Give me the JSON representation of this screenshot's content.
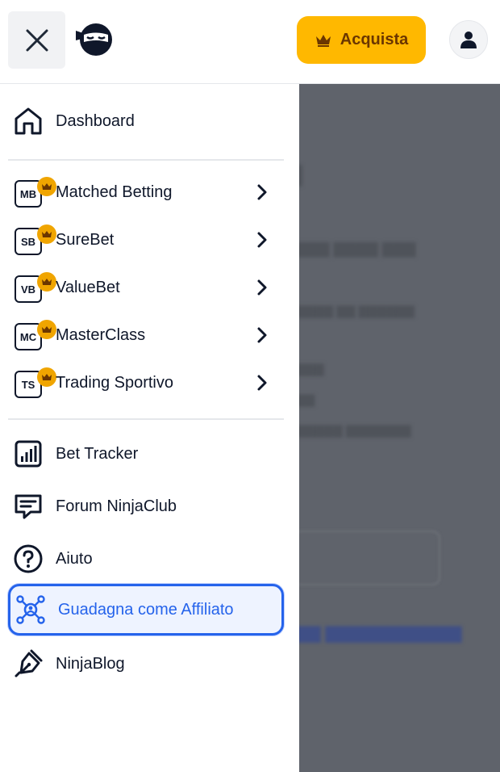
{
  "header": {
    "buy_label": "Acquista"
  },
  "icons": {
    "close": "close-icon",
    "logo": "ninja-logo",
    "crown": "crown-icon",
    "user": "user-icon"
  },
  "colors": {
    "accent": "#ffb800",
    "active": "#2563eb",
    "overlay": "#5f636b",
    "crown_badge": "#f0a500"
  },
  "menu": {
    "dashboard": "Dashboard",
    "premium": [
      {
        "label": "Matched Betting",
        "code": "MB"
      },
      {
        "label": "SureBet",
        "code": "SB"
      },
      {
        "label": "ValueBet",
        "code": "VB"
      },
      {
        "label": "MasterClass",
        "code": "MC"
      },
      {
        "label": "Trading Sportivo",
        "code": "TS"
      }
    ],
    "bet_tracker": "Bet Tracker",
    "forum": "Forum NinjaClub",
    "help": "Aiuto",
    "affiliate": "Guadagna come Affiliato",
    "blog": "NinjaBlog"
  }
}
